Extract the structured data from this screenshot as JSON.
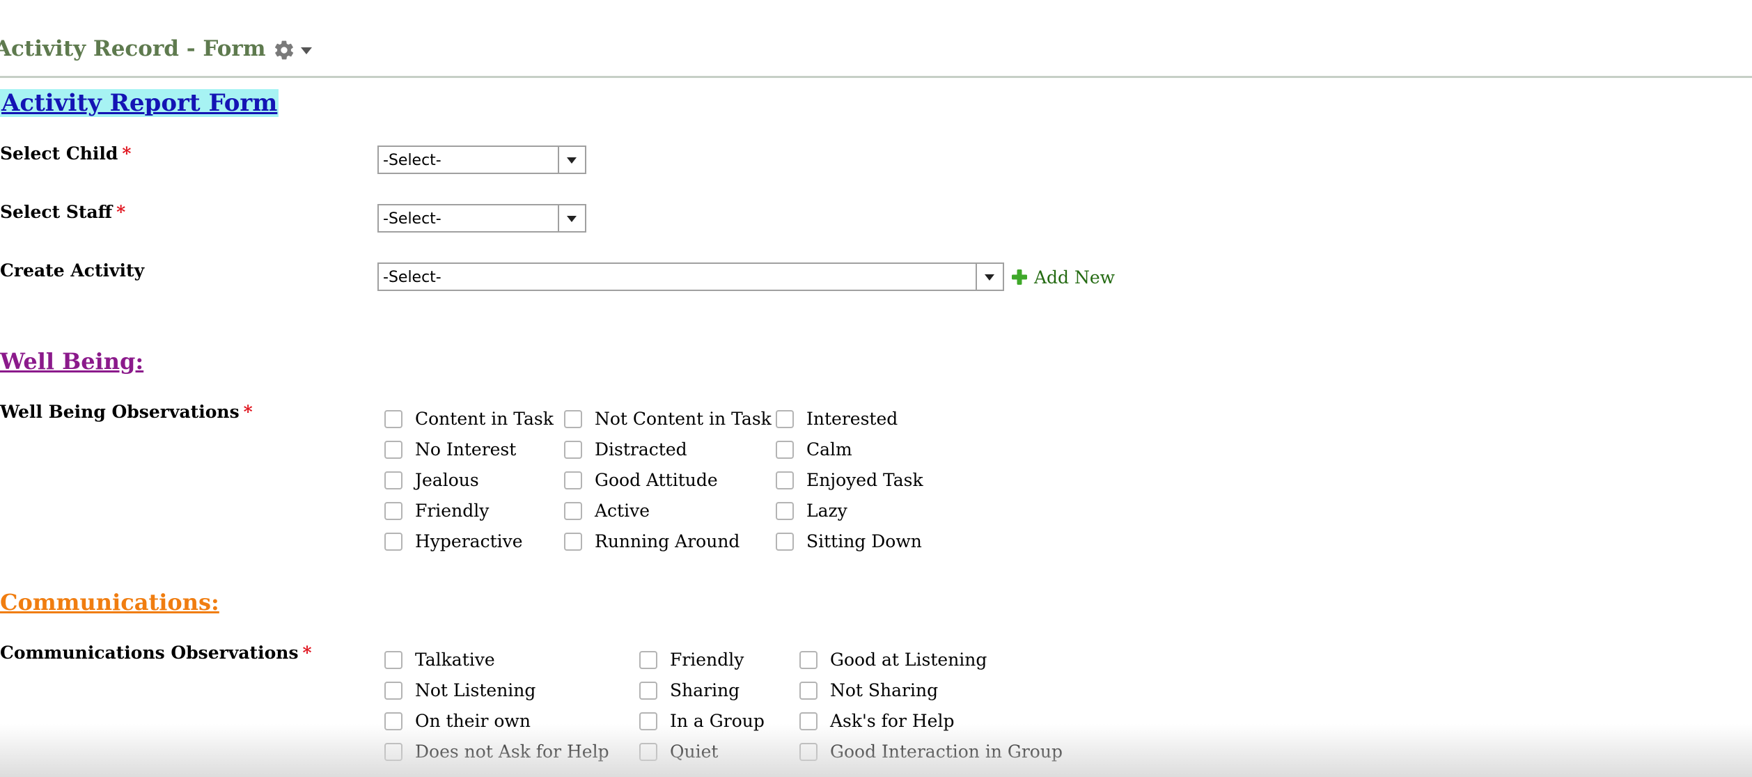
{
  "header": {
    "title": "Activity Record - Form",
    "settings_icon": "gear-icon",
    "dropdown_icon": "caret-down-icon"
  },
  "form": {
    "title": "Activity Report Form",
    "required_marker": "*",
    "fields": {
      "child": {
        "label": "Select Child",
        "value": "-Select-",
        "required": true
      },
      "staff": {
        "label": "Select Staff",
        "value": "-Select-",
        "required": true
      },
      "activity": {
        "label": "Create Activity",
        "value": "-Select-",
        "add_new_label": "Add New",
        "add_icon": "plus-icon"
      }
    }
  },
  "well_being": {
    "title": "Well Being:",
    "title_color": "#8b1a8b",
    "observations_label": "Well Being Observations",
    "options": [
      "Content in Task",
      "No Interest",
      "Jealous",
      "Friendly",
      "Hyperactive",
      "Not Content in Task",
      "Distracted",
      "Good Attitude",
      "Active",
      "Running Around",
      "Interested",
      "Calm",
      "Enjoyed Task",
      "Lazy",
      "Sitting Down"
    ]
  },
  "communications": {
    "title": "Communications:",
    "title_color": "#f07d10",
    "observations_label": "Communications Observations",
    "options": [
      "Talkative",
      "Not Listening",
      "On their own",
      "Does not Ask for Help",
      "Friendly",
      "Sharing",
      "In a Group",
      "Quiet",
      "Good at Listening",
      "Not Sharing",
      "Ask's for Help",
      "Good Interaction in Group"
    ]
  },
  "colors": {
    "header_title": "#5e7a4e",
    "form_title_text": "#1414b4",
    "form_title_bg": "#a7f3f3",
    "required": "#e0141e",
    "add_new": "#246a12"
  }
}
